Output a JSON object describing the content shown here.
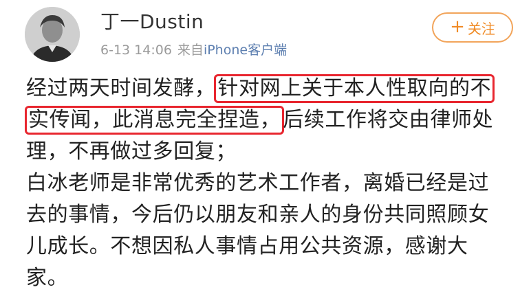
{
  "post": {
    "author": "丁一Dustin",
    "time": "6-13 14:06",
    "via": "来自",
    "client": "iPhone客户端",
    "follow_label": "关注",
    "follow_plus": "+",
    "highlight_color": "#e8262f",
    "accent_color": "#f08a24",
    "lines": [
      [
        "经过两天时间发酵，",
        "",
        ""
      ],
      [
        "",
        "实传闻，此消息完全捏造，",
        "后续工作将交由律师处"
      ],
      [
        "理，不再做过多回复；",
        "",
        ""
      ],
      [
        "白冰老师是非常优秀的艺术工作者，离婚已经是过",
        "",
        ""
      ],
      [
        "去的事情，今后仍以朋友和亲人的身份共同照顾女",
        "",
        ""
      ],
      [
        "儿成长。不想因私人事情占用公共资源，感谢大",
        "",
        ""
      ],
      [
        "家。",
        "",
        ""
      ]
    ],
    "line1_highlight": "针对网上关于本人性取向的不"
  }
}
